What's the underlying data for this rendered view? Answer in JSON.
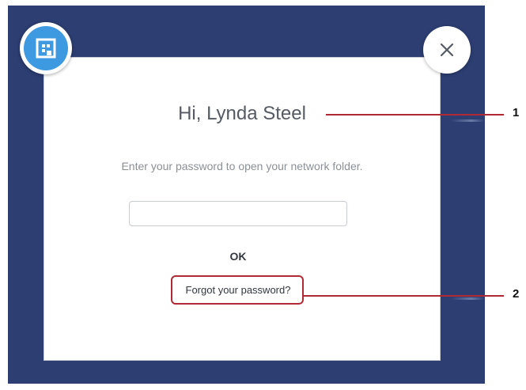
{
  "dialog": {
    "greeting": "Hi, Lynda Steel",
    "instruction": "Enter your password to open your network folder.",
    "password_value": "",
    "ok_label": "OK",
    "forgot_link": "Forgot your password?"
  },
  "icons": {
    "app_badge": "app-logo-icon",
    "close": "close-icon"
  },
  "callouts": [
    {
      "number": "1",
      "target": "greeting"
    },
    {
      "number": "2",
      "target": "forgot-link"
    }
  ],
  "colors": {
    "backdrop": "#2c3e72",
    "accent": "#3d9ae0",
    "callout": "#b02a36"
  }
}
